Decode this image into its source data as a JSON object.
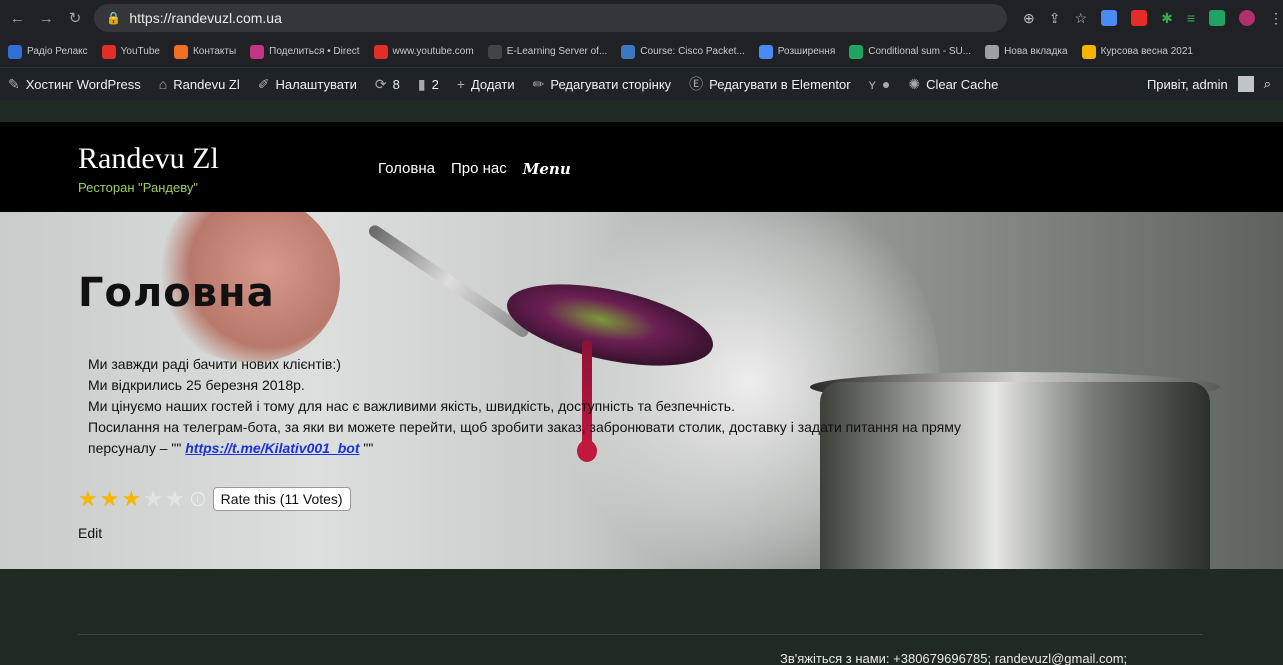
{
  "browser": {
    "url": "https://randevuzl.com.ua"
  },
  "bookmarks": [
    {
      "label": "Радіо Релакс",
      "color": "#2f6fd6"
    },
    {
      "label": "YouTube",
      "color": "#e52d27"
    },
    {
      "label": "Контакты",
      "color": "#f07020"
    },
    {
      "label": "Поделиться • Direct",
      "color": "#c13584"
    },
    {
      "label": "www.youtube.com",
      "color": "#e52d27"
    },
    {
      "label": "E-Learning Server of...",
      "color": "#444444"
    },
    {
      "label": "Course: Cisco Packet...",
      "color": "#3a78c2"
    },
    {
      "label": "Розширення",
      "color": "#4a8af4"
    },
    {
      "label": "Conditional sum - SU...",
      "color": "#1fa463"
    },
    {
      "label": "Нова вкладка",
      "color": "#9aa0a6"
    },
    {
      "label": "Курсова весна 2021",
      "color": "#f4b400"
    }
  ],
  "adminbar": {
    "hosting": "Хостинг WordPress",
    "site": "Randevu Zl",
    "customize": "Налаштувати",
    "updates": "8",
    "comments": "2",
    "add_new": "Додати",
    "edit_page": "Редагувати сторінку",
    "edit_elementor": "Редагувати в Elementor",
    "clear_cache": "Clear Cache",
    "greeting": "Привіт, admin"
  },
  "site": {
    "title": "Randevu Zl",
    "tagline": "Ресторан \"Рандеву\"",
    "menu": [
      "Головна",
      "Про нас",
      "Menu"
    ]
  },
  "page": {
    "title": "Головна",
    "lines": [
      "Ми завжди раді бачити нових клієнтів:)",
      "Ми відкрились 25 березня 2018р.",
      "Ми цінуємо наших гостей і тому для нас є важливими якість, швидкість, доступність та безпечність.",
      "Посилання на телеграм-бота, за яки ви можете перейти, щоб зробити заказ, забронювати столик, доставку і задати     питання на пряму"
    ],
    "last_line_prefix": "персуналу – \"\" ",
    "bot_link": "https://t.me/Kilativ001_bot",
    "last_line_suffix": " \"\"",
    "rating": {
      "stars_on": 3,
      "stars_total": 5,
      "button": "Rate this (11 Votes)"
    },
    "edit": "Edit"
  },
  "footer": {
    "contact": "Зв'яжіться з нами: +380679696785; randevuzl@gmail.com;"
  }
}
